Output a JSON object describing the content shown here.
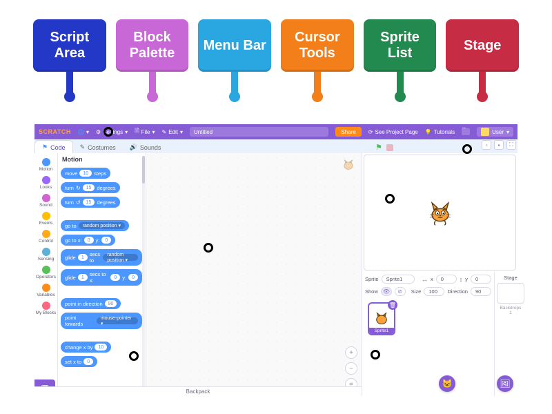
{
  "labels": {
    "script_area": "Script Area",
    "block_palette": "Block Palette",
    "menu_bar": "Menu Bar",
    "cursor_tools": "Cursor Tools",
    "sprite_list": "Sprite List",
    "stage": "Stage"
  },
  "menubar": {
    "brand": "SCRATCH",
    "settings": "Settings",
    "file": "File",
    "edit": "Edit",
    "project_title": "Untitled",
    "share": "Share",
    "see_project": "See Project Page",
    "tutorials": "Tutorials",
    "user": "User"
  },
  "tabs": {
    "code": "Code",
    "costumes": "Costumes",
    "sounds": "Sounds"
  },
  "categories": [
    {
      "name": "Motion",
      "color": "#4c97ff"
    },
    {
      "name": "Looks",
      "color": "#9966ff"
    },
    {
      "name": "Sound",
      "color": "#cf63cf"
    },
    {
      "name": "Events",
      "color": "#ffbf00"
    },
    {
      "name": "Control",
      "color": "#ffab19"
    },
    {
      "name": "Sensing",
      "color": "#5cb1d6"
    },
    {
      "name": "Operators",
      "color": "#59c059"
    },
    {
      "name": "Variables",
      "color": "#ff8c1a"
    },
    {
      "name": "My Blocks",
      "color": "#ff6680"
    }
  ],
  "palette": {
    "title": "Motion",
    "blocks": {
      "move_steps_label_a": "move",
      "move_steps_val": "10",
      "move_steps_label_b": "steps",
      "turn_cw_a": "turn",
      "turn_cw_val": "15",
      "turn_cw_b": "degrees",
      "turn_ccw_a": "turn",
      "turn_ccw_val": "15",
      "turn_ccw_b": "degrees",
      "goto_a": "go to",
      "goto_target": "random position ▾",
      "gotoxy_a": "go to x:",
      "gotoxy_x": "0",
      "gotoxy_b": "y:",
      "gotoxy_y": "0",
      "glide_rand_a": "glide",
      "glide_rand_secs": "1",
      "glide_rand_b": "secs to",
      "glide_rand_target": "random position ▾",
      "glide_xy_a": "glide",
      "glide_xy_secs": "1",
      "glide_xy_b": "secs to x:",
      "glide_xy_x": "0",
      "glide_xy_c": "y:",
      "glide_xy_y": "0",
      "point_dir_a": "point in direction",
      "point_dir_val": "90",
      "point_toward_a": "point towards",
      "point_toward_target": "mouse-pointer ▾",
      "changexby_a": "change x by",
      "changexby_val": "10",
      "setx_a": "set x to",
      "setx_val": "0"
    }
  },
  "sprite_info": {
    "label_sprite": "Sprite",
    "name": "Sprite1",
    "x_label": "x",
    "x": "0",
    "y_label": "y",
    "y": "0",
    "show_label": "Show",
    "size_label": "Size",
    "size": "100",
    "dir_label": "Direction",
    "dir": "90"
  },
  "stage_col": {
    "title": "Stage",
    "backdrops_label": "Backdrops",
    "backdrops_count": "1"
  },
  "backpack": {
    "label": "Backpack"
  }
}
